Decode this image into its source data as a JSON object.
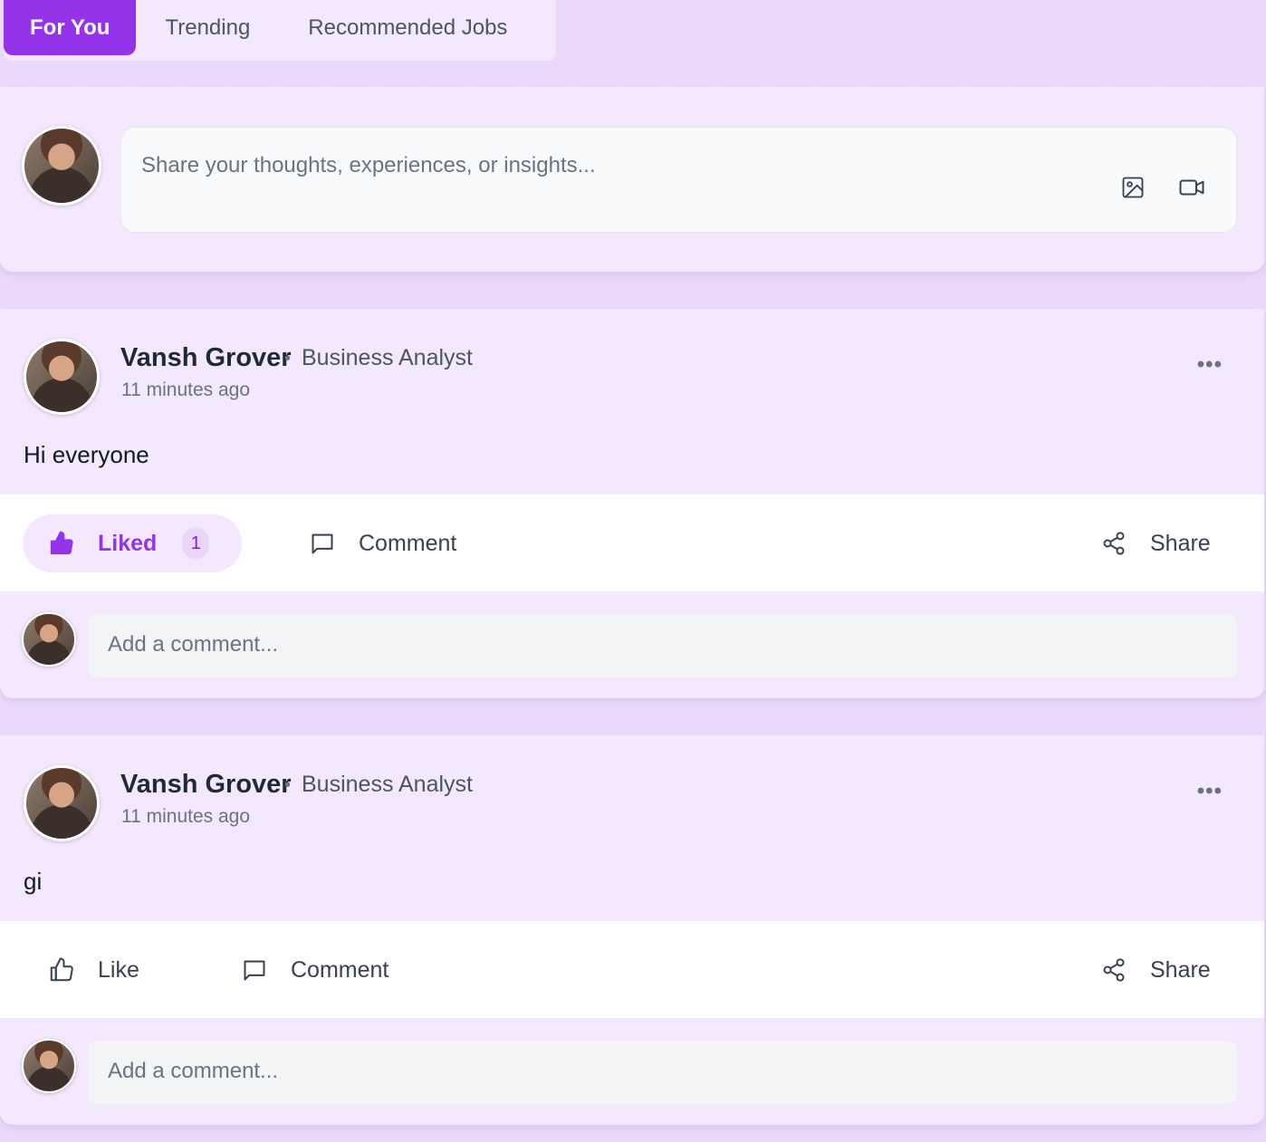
{
  "tabs": [
    {
      "label": "For You",
      "active": true
    },
    {
      "label": "Trending",
      "active": false
    },
    {
      "label": "Recommended Jobs",
      "active": false
    }
  ],
  "composer": {
    "placeholder": "Share your thoughts, experiences, or insights...",
    "image_icon": "image-icon",
    "video_icon": "video-icon"
  },
  "colors": {
    "accent": "#9333ea",
    "accent_light": "#f3e8fd",
    "background": "#faf5ff"
  },
  "posts": [
    {
      "author": "Vansh Grover",
      "separator": "•",
      "role": "Business Analyst",
      "time": "11 minutes ago",
      "more": "•••",
      "content": "Hi everyone",
      "like_label": "Liked",
      "liked": true,
      "like_count": "1",
      "comment_label": "Comment",
      "share_label": "Share",
      "comment_placeholder": "Add a comment..."
    },
    {
      "author": "Vansh Grover",
      "separator": "•",
      "role": "Business Analyst",
      "time": "11 minutes ago",
      "more": "•••",
      "content": "gi",
      "like_label": "Like",
      "liked": false,
      "comment_label": "Comment",
      "share_label": "Share",
      "comment_placeholder": "Add a comment..."
    }
  ]
}
